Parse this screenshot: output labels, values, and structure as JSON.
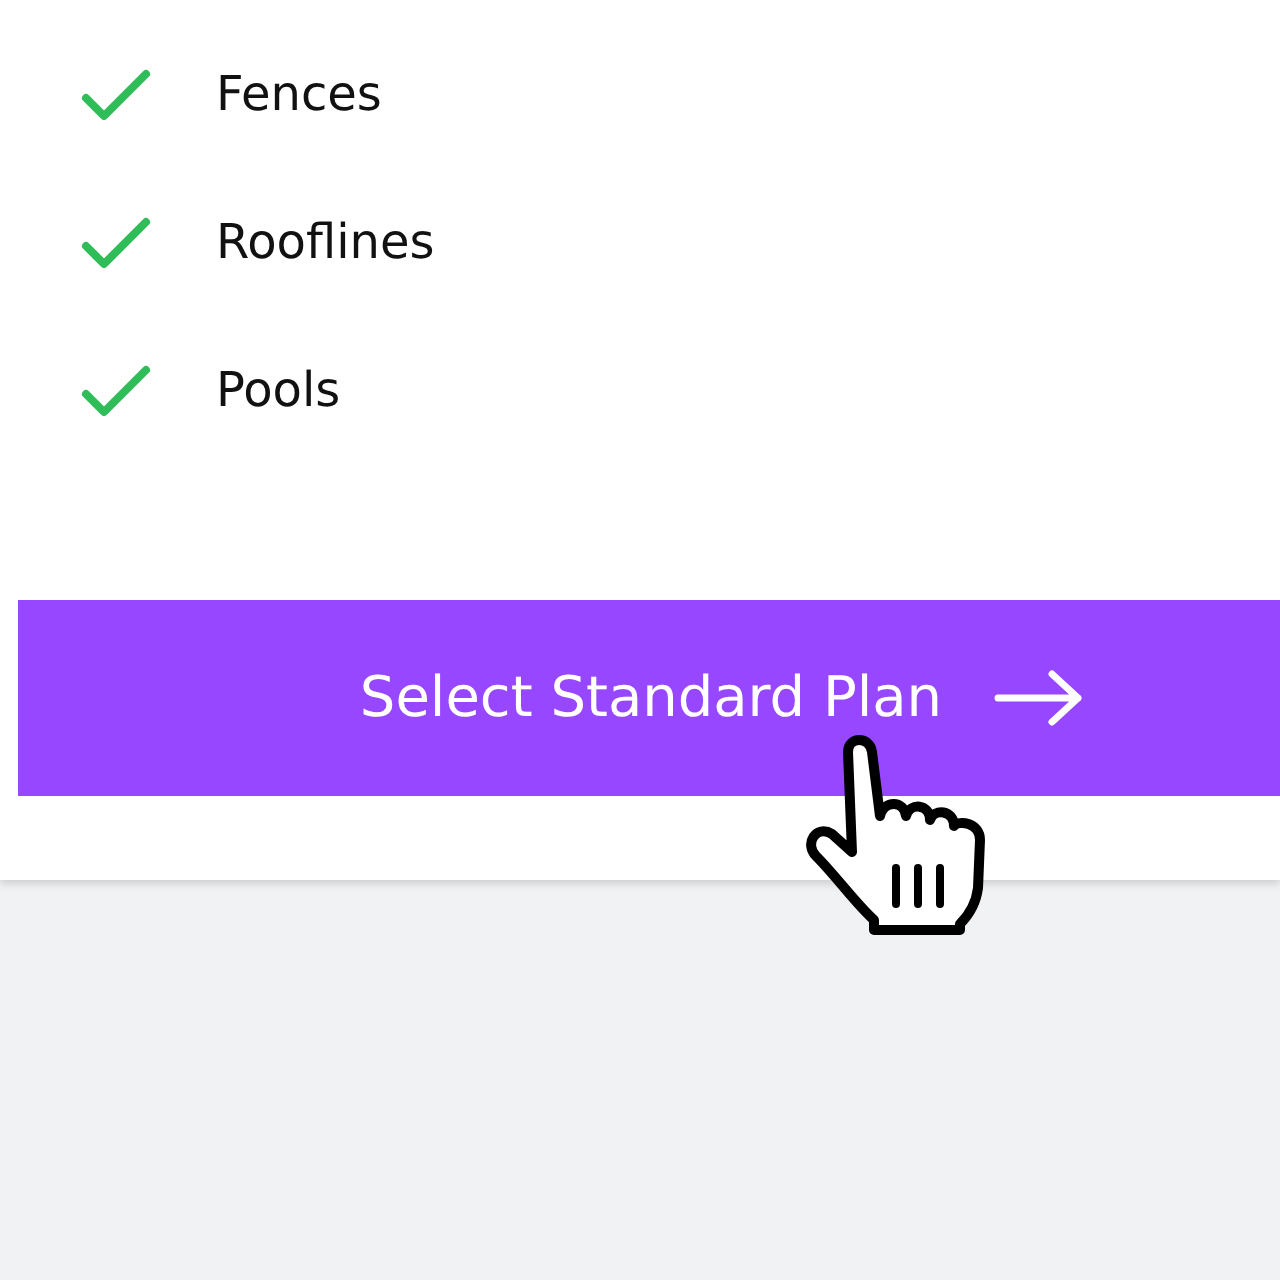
{
  "features": [
    {
      "label": "Fences",
      "included": true
    },
    {
      "label": "Rooflines",
      "included": true
    },
    {
      "label": "Pools",
      "included": true
    }
  ],
  "button": {
    "label": "Select Standard Plan"
  }
}
